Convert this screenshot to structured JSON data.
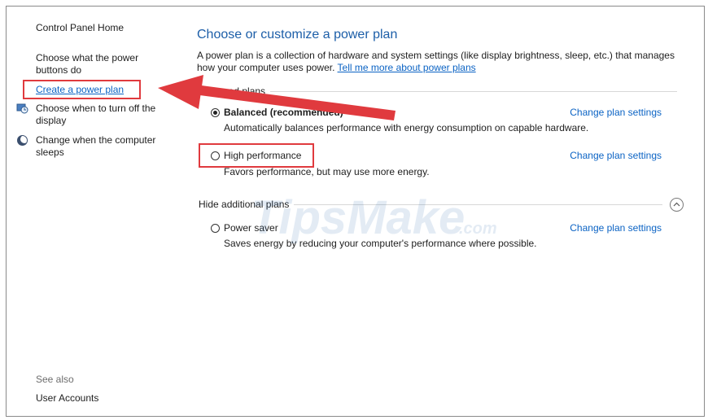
{
  "sidebar": {
    "home": "Control Panel Home",
    "items": [
      {
        "label_1": "Choose what the power",
        "label_2": "buttons do"
      },
      {
        "label_1": "Create a power plan"
      },
      {
        "label_1": "Choose when to turn off the",
        "label_2": "display"
      },
      {
        "label_1": "Change when the computer",
        "label_2": "sleeps"
      }
    ],
    "see_also": "See also",
    "user_accounts": "User Accounts"
  },
  "main": {
    "title": "Choose or customize a power plan",
    "description": "A power plan is a collection of hardware and system settings (like display brightness, sleep, etc.) that manages how your computer uses power.",
    "tell_more": "Tell me more about power plans",
    "preferred_label": "Preferred plans",
    "hide_label": "Hide additional plans",
    "plans": [
      {
        "name": "Balanced (recommended)",
        "desc": "Automatically balances performance with energy consumption on capable hardware.",
        "selected": true,
        "change": "Change plan settings"
      },
      {
        "name": "High performance",
        "desc": "Favors performance, but may use more energy.",
        "selected": false,
        "change": "Change plan settings"
      },
      {
        "name": "Power saver",
        "desc": "Saves energy by reducing your computer's performance where possible.",
        "selected": false,
        "change": "Change plan settings"
      }
    ]
  },
  "watermark": {
    "brand": "TipsMake",
    "suffix": ".com"
  },
  "colors": {
    "link": "#0b63c4",
    "title": "#1c5ea8",
    "highlight": "#e03a3e"
  }
}
